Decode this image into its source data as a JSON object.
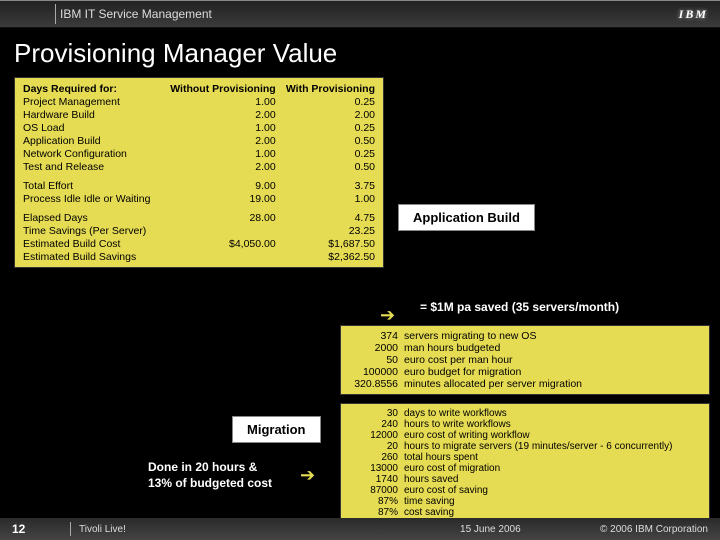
{
  "header": {
    "product": "IBM IT Service Management",
    "logo": "IBM"
  },
  "title": "Provisioning Manager Value",
  "table1": {
    "headers": [
      "Days Required for:",
      "Without Provisioning",
      "With Provisioning"
    ],
    "rows": [
      {
        "l": "Project Management",
        "a": "1.00",
        "b": "0.25"
      },
      {
        "l": "Hardware Build",
        "a": "2.00",
        "b": "2.00"
      },
      {
        "l": "OS Load",
        "a": "1.00",
        "b": "0.25"
      },
      {
        "l": "Application Build",
        "a": "2.00",
        "b": "0.50"
      },
      {
        "l": "Network Configuration",
        "a": "1.00",
        "b": "0.25"
      },
      {
        "l": "Test and Release",
        "a": "2.00",
        "b": "0.50"
      }
    ],
    "sub1": [
      {
        "l": "Total Effort",
        "a": "9.00",
        "b": "3.75"
      },
      {
        "l": "Process Idle Idle or Waiting",
        "a": "19.00",
        "b": "1.00"
      }
    ],
    "sub2": [
      {
        "l": "Elapsed Days",
        "a": "28.00",
        "b": "4.75"
      },
      {
        "l": "Time Savings (Per Server)",
        "a": "",
        "b": "23.25"
      },
      {
        "l": "Estimated Build Cost",
        "a": "$4,050.00",
        "b": "$1,687.50"
      },
      {
        "l": "Estimated Build Savings",
        "a": "",
        "b": "$2,362.50"
      }
    ]
  },
  "callouts": {
    "appBuild": "Application Build",
    "saved": "= $1M pa saved  (35 servers/month)",
    "migration": "Migration",
    "doneL1": "Done in 20 hours &",
    "doneL2": "13% of budgeted cost"
  },
  "migrationBox": [
    {
      "v": "374",
      "l": "servers migrating to new OS"
    },
    {
      "v": "2000",
      "l": "man hours budgeted"
    },
    {
      "v": "50",
      "l": "euro cost per man hour"
    },
    {
      "v": "100000",
      "l": "euro budget for migration"
    },
    {
      "v": "320.8556",
      "l": "minutes allocated per server migration"
    }
  ],
  "resultBox": [
    {
      "v": "30",
      "l": "days to write workflows"
    },
    {
      "v": "240",
      "l": "hours to write workflows"
    },
    {
      "v": "12000",
      "l": "euro cost of writing workflow"
    },
    {
      "v": "20",
      "l": "hours to migrate servers (19 minutes/server - 6 concurrently)"
    },
    {
      "v": "260",
      "l": "total hours spent"
    },
    {
      "v": "13000",
      "l": "euro cost of migration"
    },
    {
      "v": "1740",
      "l": "hours saved"
    },
    {
      "v": "87000",
      "l": "euro cost of saving"
    },
    {
      "v": "87%",
      "l": "time saving"
    },
    {
      "v": "87%",
      "l": "cost saving"
    }
  ],
  "footer": {
    "page": "12",
    "event": "Tivoli Live!",
    "date": "15 June 2006",
    "corp": "© 2006 IBM Corporation"
  }
}
